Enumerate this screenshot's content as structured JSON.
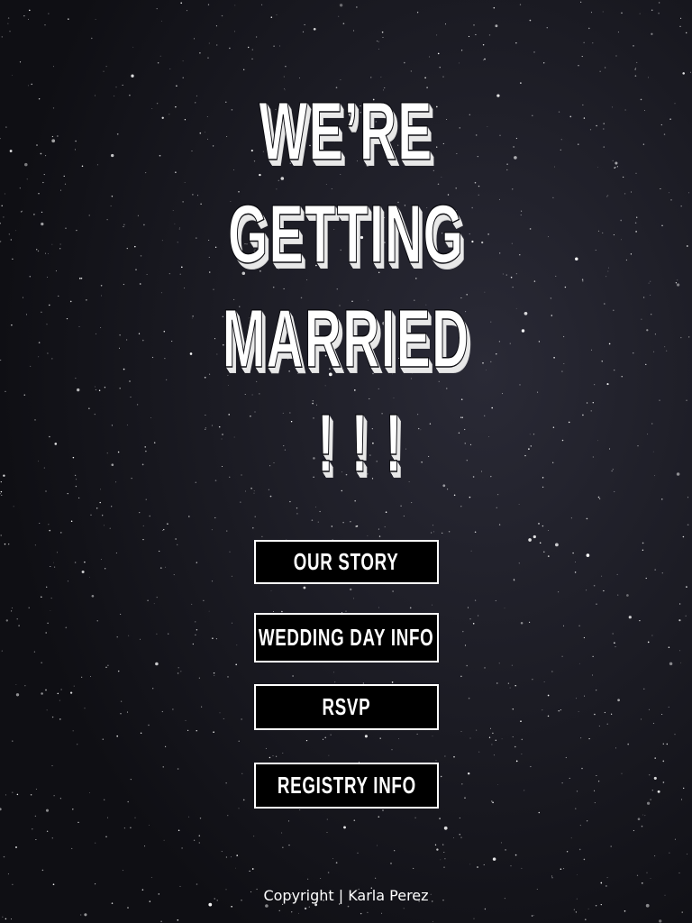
{
  "headline": {
    "line1": "WE’RE",
    "line2": "GETTING",
    "line3": "MARRIED",
    "line4": "!!!"
  },
  "nav": {
    "our_story": "OUR STORY",
    "wedding_day_info": "WEDDING DAY INFO",
    "rsvp": "RSVP",
    "registry_info": "REGISTRY INFO"
  },
  "footer": {
    "copyright": "Copyright | Karla Perez"
  },
  "colors": {
    "background": "#14141a",
    "button_bg": "#000000",
    "button_border": "#ffffff",
    "text": "#ffffff"
  }
}
